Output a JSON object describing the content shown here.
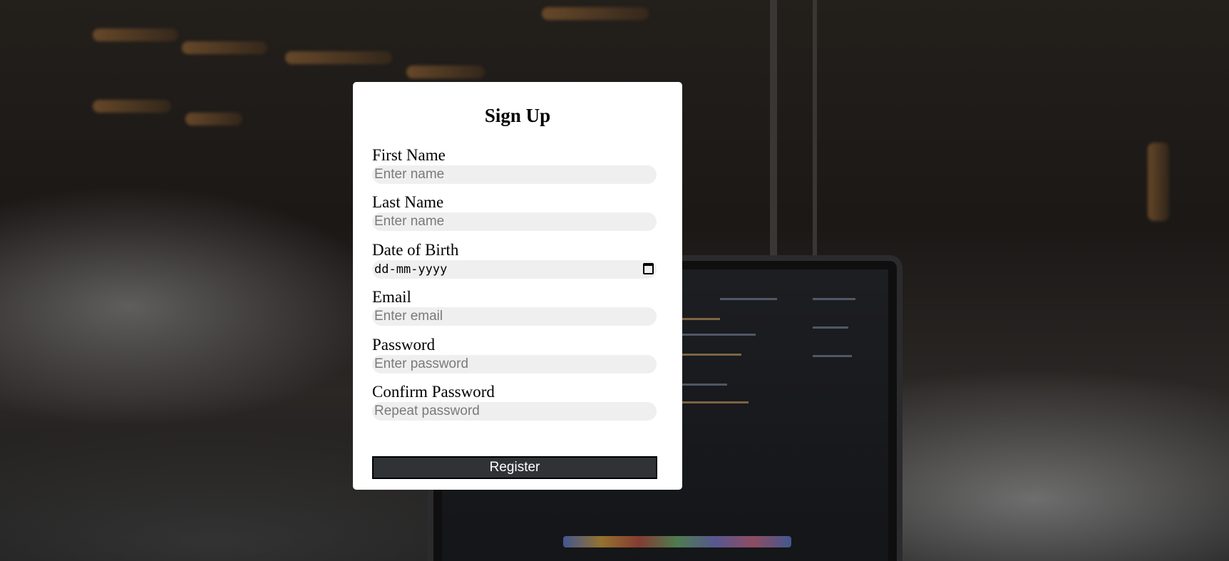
{
  "form": {
    "title": "Sign Up",
    "fields": [
      {
        "label": "First Name",
        "placeholder": "Enter name",
        "type": "text"
      },
      {
        "label": "Last Name",
        "placeholder": "Enter name",
        "type": "text"
      },
      {
        "label": "Date of Birth",
        "placeholder": "dd-mm-yyyy",
        "type": "date"
      },
      {
        "label": "Email",
        "placeholder": "Enter email",
        "type": "email"
      },
      {
        "label": "Password",
        "placeholder": "Enter password",
        "type": "password"
      },
      {
        "label": "Confirm Password",
        "placeholder": "Repeat password",
        "type": "password"
      }
    ],
    "submit_label": "Register"
  },
  "icons": {
    "date_picker": "calendar-icon"
  },
  "colors": {
    "card_background": "#ffffff",
    "input_background": "#efefef",
    "button_background": "#2f3336",
    "button_text": "#ffffff"
  }
}
